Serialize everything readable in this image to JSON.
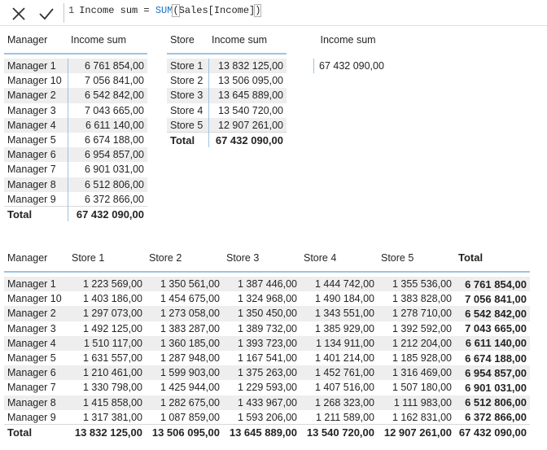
{
  "formula_bar": {
    "line_number": "1",
    "code_before": "Income sum = ",
    "function_name": "SUM",
    "open_paren": "(",
    "argument": "Sales[Income]",
    "close_paren": ")",
    "cancel_icon": "close-icon",
    "commit_icon": "check-icon"
  },
  "manager_table": {
    "headers": [
      "Manager",
      "Income sum"
    ],
    "rows": [
      [
        "Manager 1",
        "6 761 854,00"
      ],
      [
        "Manager 10",
        "7 056 841,00"
      ],
      [
        "Manager 2",
        "6 542 842,00"
      ],
      [
        "Manager 3",
        "7 043 665,00"
      ],
      [
        "Manager 4",
        "6 611 140,00"
      ],
      [
        "Manager 5",
        "6 674 188,00"
      ],
      [
        "Manager 6",
        "6 954 857,00"
      ],
      [
        "Manager 7",
        "6 901 031,00"
      ],
      [
        "Manager 8",
        "6 512 806,00"
      ],
      [
        "Manager 9",
        "6 372 866,00"
      ]
    ],
    "total": [
      "Total",
      "67 432 090,00"
    ]
  },
  "store_table": {
    "headers": [
      "Store",
      "Income sum"
    ],
    "rows": [
      [
        "Store 1",
        "13 832 125,00"
      ],
      [
        "Store 2",
        "13 506 095,00"
      ],
      [
        "Store 3",
        "13 645 889,00"
      ],
      [
        "Store 4",
        "13 540 720,00"
      ],
      [
        "Store 5",
        "12 907 261,00"
      ]
    ],
    "total": [
      "Total",
      "67 432 090,00"
    ]
  },
  "income_card": {
    "header": "Income sum",
    "value": "67 432 090,00"
  },
  "matrix": {
    "headers": [
      "Manager",
      "Store 1",
      "Store 2",
      "Store 3",
      "Store 4",
      "Store 5",
      "Total"
    ],
    "rows": [
      [
        "Manager 1",
        "1 223 569,00",
        "1 350 561,00",
        "1 387 446,00",
        "1 444 742,00",
        "1 355 536,00",
        "6 761 854,00"
      ],
      [
        "Manager 10",
        "1 403 186,00",
        "1 454 675,00",
        "1 324 968,00",
        "1 490 184,00",
        "1 383 828,00",
        "7 056 841,00"
      ],
      [
        "Manager 2",
        "1 297 073,00",
        "1 273 058,00",
        "1 350 450,00",
        "1 343 551,00",
        "1 278 710,00",
        "6 542 842,00"
      ],
      [
        "Manager 3",
        "1 492 125,00",
        "1 383 287,00",
        "1 389 732,00",
        "1 385 929,00",
        "1 392 592,00",
        "7 043 665,00"
      ],
      [
        "Manager 4",
        "1 510 117,00",
        "1 360 185,00",
        "1 393 723,00",
        "1 134 911,00",
        "1 212 204,00",
        "6 611 140,00"
      ],
      [
        "Manager 5",
        "1 631 557,00",
        "1 287 948,00",
        "1 167 541,00",
        "1 401 214,00",
        "1 185 928,00",
        "6 674 188,00"
      ],
      [
        "Manager 6",
        "1 210 461,00",
        "1 599 903,00",
        "1 375 263,00",
        "1 452 761,00",
        "1 316 469,00",
        "6 954 857,00"
      ],
      [
        "Manager 7",
        "1 330 798,00",
        "1 425 944,00",
        "1 229 593,00",
        "1 407 516,00",
        "1 507 180,00",
        "6 901 031,00"
      ],
      [
        "Manager 8",
        "1 415 858,00",
        "1 282 675,00",
        "1 433 967,00",
        "1 268 323,00",
        "1 111 983,00",
        "6 512 806,00"
      ],
      [
        "Manager 9",
        "1 317 381,00",
        "1 087 859,00",
        "1 593 206,00",
        "1 211 589,00",
        "1 162 831,00",
        "6 372 866,00"
      ]
    ],
    "total": [
      "Total",
      "13 832 125,00",
      "13 506 095,00",
      "13 645 889,00",
      "13 540 720,00",
      "12 907 261,00",
      "67 432 090,00"
    ]
  }
}
